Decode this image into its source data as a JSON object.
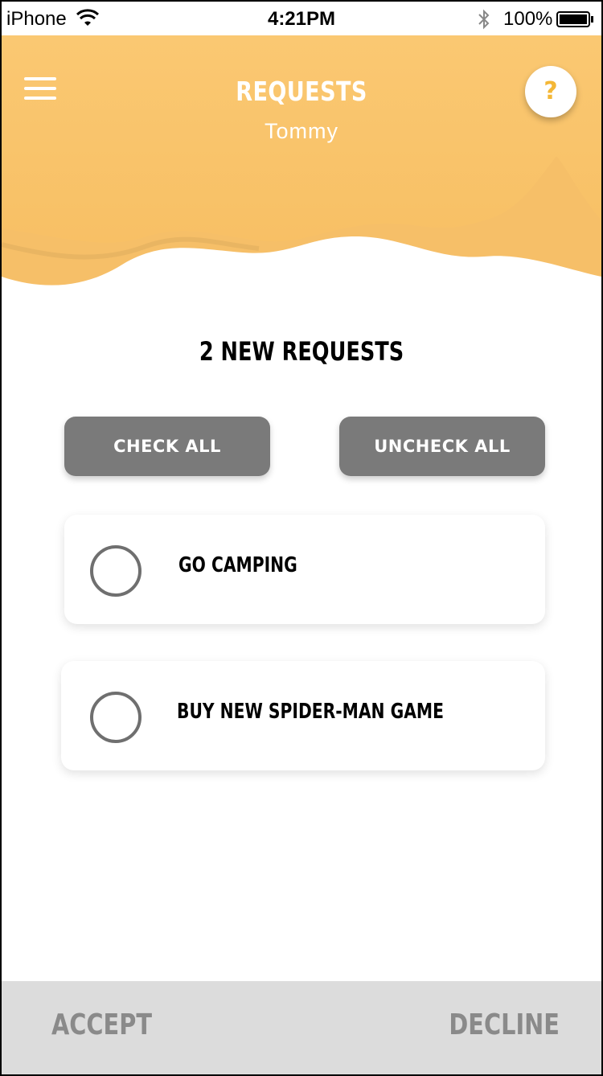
{
  "status_bar": {
    "carrier": "iPhone",
    "time": "4:21PM",
    "battery": "100%"
  },
  "header": {
    "title": "REQUESTS",
    "subtitle": "Tommy",
    "help_label": "?",
    "gradient_top": "#fac872",
    "gradient_bottom": "#f8c166"
  },
  "main": {
    "count_heading": "2 NEW REQUESTS",
    "check_all_label": "CHECK ALL",
    "uncheck_all_label": "UNCHECK ALL",
    "requests": [
      {
        "label": "GO CAMPING",
        "checked": false
      },
      {
        "label": "BUY NEW SPIDER-MAN GAME",
        "checked": false
      }
    ]
  },
  "footer": {
    "accept_label": "ACCEPT",
    "decline_label": "DECLINE"
  },
  "colors": {
    "accent": "#f4b736",
    "button_gray": "#7a7a7a",
    "footer_bg": "#dcdcdc",
    "footer_text": "#8a8a8a"
  }
}
